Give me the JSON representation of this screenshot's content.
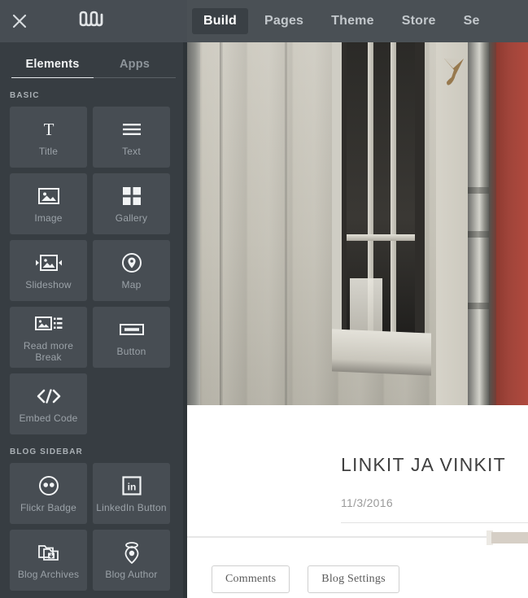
{
  "sidebar": {
    "close_icon": "close-icon",
    "logo_icon": "weebly-logo-icon",
    "tabs": [
      {
        "label": "Elements",
        "active": true
      },
      {
        "label": "Apps",
        "active": false
      }
    ],
    "sections": [
      {
        "heading": "BASIC",
        "tiles": [
          {
            "label": "Title",
            "icon": "title-icon"
          },
          {
            "label": "Text",
            "icon": "text-lines-icon"
          },
          {
            "label": "Image",
            "icon": "image-icon"
          },
          {
            "label": "Gallery",
            "icon": "gallery-grid-icon"
          },
          {
            "label": "Slideshow",
            "icon": "slideshow-icon"
          },
          {
            "label": "Map",
            "icon": "map-pin-icon"
          },
          {
            "label": "Read more Break",
            "icon": "read-more-break-icon"
          },
          {
            "label": "Button",
            "icon": "button-icon"
          },
          {
            "label": "Embed Code",
            "icon": "embed-code-icon"
          }
        ]
      },
      {
        "heading": "BLOG SIDEBAR",
        "tiles": [
          {
            "label": "Flickr Badge",
            "icon": "flickr-icon"
          },
          {
            "label": "LinkedIn Button",
            "icon": "linkedin-icon"
          },
          {
            "label": "Blog Archives",
            "icon": "blog-archives-icon"
          },
          {
            "label": "Blog Author",
            "icon": "blog-author-icon"
          }
        ]
      }
    ]
  },
  "topnav": {
    "items": [
      {
        "label": "Build",
        "active": true
      },
      {
        "label": "Pages",
        "active": false
      },
      {
        "label": "Theme",
        "active": false
      },
      {
        "label": "Store",
        "active": false
      },
      {
        "label": "Se",
        "active": false
      }
    ]
  },
  "hero": {
    "alt": "photo of white wooden building wall with window, drainpipe and red wall"
  },
  "post": {
    "title": "LINKIT JA VINKIT",
    "date": "11/3/2016"
  },
  "footer": {
    "comments_label": "Comments",
    "blog_settings_label": "Blog Settings"
  },
  "colors": {
    "sidebar_bg": "#373d42",
    "sidebar_topbar": "#474d53",
    "tile_bg": "#474d53",
    "topnav_bg": "#4a5055",
    "topnav_active": "#3a4045",
    "accent_text": "#ffffff",
    "muted_text": "#9ba2a8",
    "beige": "#d6cfc6",
    "red_wall": "#a0443a"
  }
}
